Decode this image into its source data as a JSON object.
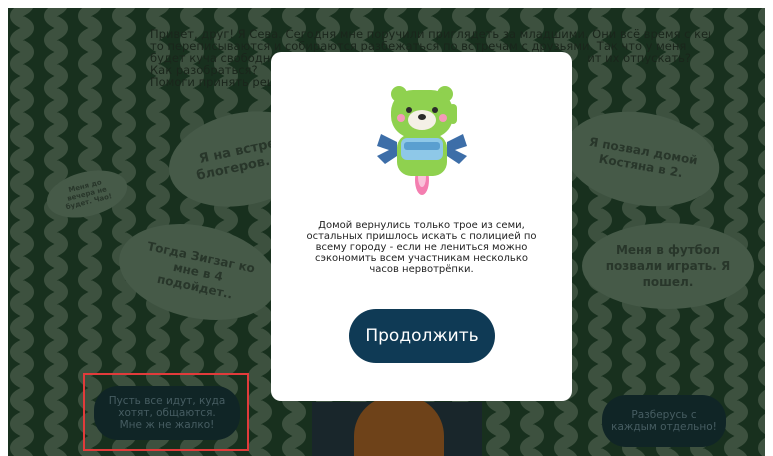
{
  "intro": {
    "lines": [
      "Привет, друг! Я Сева. Сегодня мне поручили приглядеть за младшими. Они всё время с кем-",
      "то переписываются и собираются разбежаться по встречам с друзьями. Так что у меня",
      "будет куча свободно",
      "Как разобраться?",
      "Помоги принять реш"
    ],
    "line3_tail": "ит их отпускать?"
  },
  "bubbles": {
    "blogers": "Я на встречу блогеров. Пок",
    "dinner": "Меня до вечера не будет. Чао!",
    "zigzag": "Тогда Зигзаг ко мне в 4 подойдет..",
    "kostyan": "Я позвал домой Костяна в 2.",
    "football": "Меня в футбол позвали играть. Я пошел."
  },
  "options": {
    "let_go": "Пусть все идут, куда хотят, общаются. Мне ж не жалко!",
    "sort_out": "Разберусь с каждым отдельно!"
  },
  "modal": {
    "message": "Домой вернулись только трое из семи, остальных пришлось искать с полицией по всему городу - если не лениться можно сэкономить всем участникам несколько часов нервотрёпки.",
    "continue_label": "Продолжить",
    "mascot": "bear-rocket-icon"
  },
  "colors": {
    "background": "#1c3f27",
    "wave": "#5f7a63",
    "button": "#0f3a55",
    "option_pill": "#0d2a36",
    "highlight": "#e23b3b"
  }
}
